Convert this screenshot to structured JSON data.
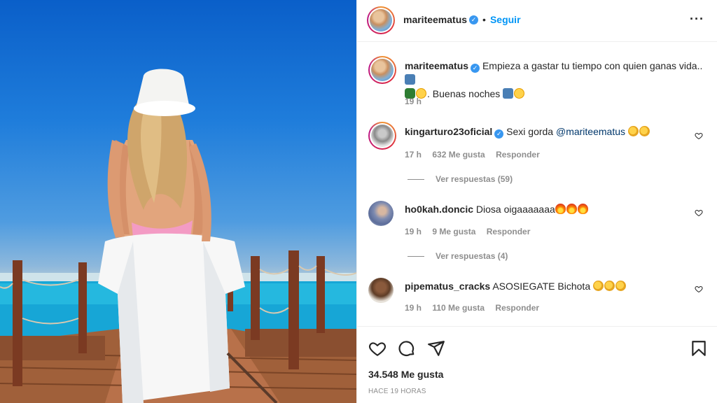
{
  "post": {
    "author": "mariteematus",
    "follow_label": "Seguir",
    "dot": "•",
    "more_icon": "more-horizontal-icon",
    "caption_line1": "Empieza a gastar tu tiempo con quien ganas vida..",
    "caption_line2": ". Buenas noches",
    "caption_time": "19 h",
    "likes": "34.548 Me gusta",
    "time_ago": "HACE 19 HORAS"
  },
  "comments": [
    {
      "user": "kingarturo23oficial",
      "verified": true,
      "text": "Sexi gorda",
      "mention": "@mariteematus",
      "time": "17 h",
      "likes": "632 Me gusta",
      "reply": "Responder",
      "view_replies": "Ver respuestas (59)"
    },
    {
      "user": "ho0kah.doncic",
      "verified": false,
      "text": "Diosa oigaaaaaaa",
      "time": "19 h",
      "likes": "9 Me gusta",
      "reply": "Responder",
      "view_replies": "Ver respuestas (4)"
    },
    {
      "user": "pipematus_cracks",
      "verified": false,
      "text": "ASOSIEGATE Bichota",
      "time": "19 h",
      "likes": "110 Me gusta",
      "reply": "Responder"
    }
  ],
  "colors": {
    "accent": "#0095f6",
    "verified": "#3897f0",
    "text": "#262626",
    "secondary": "#8e8e8e"
  },
  "icons": [
    "heart-icon",
    "comment-icon",
    "share-icon",
    "bookmark-icon",
    "verified-badge-icon"
  ]
}
